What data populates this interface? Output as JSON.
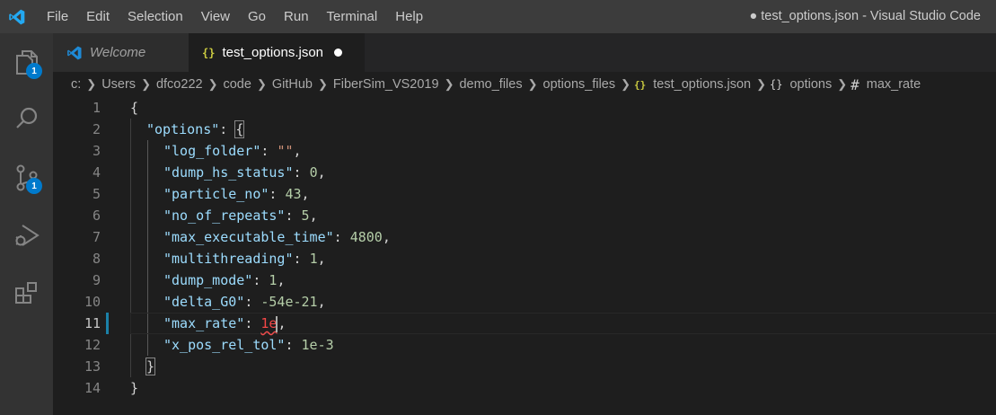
{
  "titlebar": {
    "menu": [
      "File",
      "Edit",
      "Selection",
      "View",
      "Go",
      "Run",
      "Terminal",
      "Help"
    ],
    "window_title": "● test_options.json - Visual Studio Code"
  },
  "activity": {
    "explorer_badge": "1",
    "scm_badge": "1"
  },
  "tabs": [
    {
      "label": "Welcome",
      "active": false
    },
    {
      "label": "test_options.json",
      "active": true,
      "icon": "{}"
    }
  ],
  "breadcrumb": {
    "path": [
      "c:",
      "Users",
      "dfco222",
      "code",
      "GitHub",
      "FiberSim_VS2019",
      "demo_files",
      "options_files"
    ],
    "file_icon": "{}",
    "file": "test_options.json",
    "object_icon": "{}",
    "object": "options",
    "property_icon": "#",
    "property": "max_rate"
  },
  "editor": {
    "line_numbers": [
      "1",
      "2",
      "3",
      "4",
      "5",
      "6",
      "7",
      "8",
      "9",
      "10",
      "11",
      "12",
      "13",
      "14"
    ],
    "active_line": "11",
    "lines": {
      "l1": {
        "open": "{"
      },
      "l2": {
        "key": "\"options\"",
        "colon": ": ",
        "open": "{"
      },
      "l3": {
        "key": "\"log_folder\"",
        "colon": ": ",
        "value": "\"\"",
        "comma": ","
      },
      "l4": {
        "key": "\"dump_hs_status\"",
        "colon": ": ",
        "value": "0",
        "comma": ","
      },
      "l5": {
        "key": "\"particle_no\"",
        "colon": ": ",
        "value": "43",
        "comma": ","
      },
      "l6": {
        "key": "\"no_of_repeats\"",
        "colon": ": ",
        "value": "5",
        "comma": ","
      },
      "l7": {
        "key": "\"max_executable_time\"",
        "colon": ": ",
        "value": "4800",
        "comma": ","
      },
      "l8": {
        "key": "\"multithreading\"",
        "colon": ": ",
        "value": "1",
        "comma": ","
      },
      "l9": {
        "key": "\"dump_mode\"",
        "colon": ": ",
        "value": "1",
        "comma": ","
      },
      "l10": {
        "key": "\"delta_G0\"",
        "colon": ": ",
        "value": "-54e-21",
        "comma": ","
      },
      "l11": {
        "key": "\"max_rate\"",
        "colon": ": ",
        "value": "1e",
        "comma": ","
      },
      "l12": {
        "key": "\"x_pos_rel_tol\"",
        "colon": ": ",
        "value": "1e-3"
      },
      "l13": {
        "close": "}"
      },
      "l14": {
        "close": "}"
      }
    }
  },
  "colors": {
    "key": "#9cdcfe",
    "string": "#ce9178",
    "number": "#b5cea8",
    "error": "#f44747",
    "accent": "#007acc"
  }
}
